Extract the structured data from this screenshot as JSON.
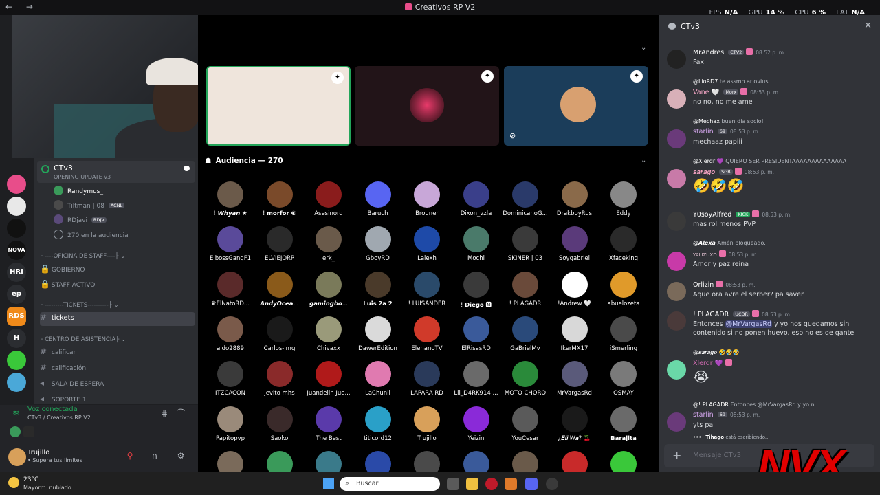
{
  "window": {
    "title": "Creativos RP V2",
    "nav": "← →",
    "perf": [
      {
        "label": "FPS",
        "value": "N/A"
      },
      {
        "label": "GPU",
        "value": "14 %"
      },
      {
        "label": "CPU",
        "value": "6 %"
      },
      {
        "label": "LAT",
        "value": "N/A"
      }
    ]
  },
  "servers": [
    "NOVA",
    "HRI",
    "ep",
    "RDS",
    "H"
  ],
  "sidebar": {
    "voice_channel": {
      "name": "CTv3",
      "sub": "OPENING UPDATE v3"
    },
    "members": [
      {
        "name": "Randymus_",
        "dim": false
      },
      {
        "name": "Tiltman | 08",
        "tag": "ACÑL",
        "dim": true
      },
      {
        "name": "RDjavi",
        "tag": "RDJV",
        "dim": true
      },
      {
        "name": "270 en la audiencia",
        "dim": true
      }
    ],
    "cat_staff": "┤----OFICINA DE STAFF----├ ⌄",
    "staff_channels": [
      "GOBIERNO",
      "STAFF ACTIVO"
    ],
    "cat_tickets": "┤---------TICKETS----------├ ⌄",
    "tickets_channel": "tickets",
    "cat_soporte": "┤CENTRO DE ASISTENCIA├ ⌄",
    "soporte_channels": [
      "calificar",
      "calificación",
      "SALA DE ESPERA",
      "SOPORTE 1"
    ],
    "voice_status": {
      "title": "Voz conectada",
      "sub": "CTv3 / Creativos RP V2"
    },
    "user": {
      "name": "Trujillo",
      "status": "• Supera tus límites"
    }
  },
  "stage": {
    "audience_header": "Audiencia — 270",
    "audience": [
      {
        "name": "! 𝙒𝙝𝙮𝙖𝙣 ★",
        "color": "#6b5a4a"
      },
      {
        "name": "! 𝗺𝗼𝗿𝗳𝗼𝗿 ☯",
        "color": "#7a4a2a"
      },
      {
        "name": "Asesinord",
        "color": "#8a1c1c"
      },
      {
        "name": "Baruch",
        "color": "#5865f2"
      },
      {
        "name": "Brouner",
        "color": "#c8a7d8"
      },
      {
        "name": "Dixon_vzla",
        "color": "#3a3f8a"
      },
      {
        "name": "DominicanoG...",
        "color": "#2a3a6a"
      },
      {
        "name": "DrakboyRus",
        "color": "#8a6a4a"
      },
      {
        "name": "Eddy",
        "color": "#888888"
      },
      {
        "name": "ElbossGangF1",
        "color": "#5a4a9a"
      },
      {
        "name": "ELVIEJORP",
        "color": "#2a2a2a"
      },
      {
        "name": "erk_",
        "color": "#6a5a4a"
      },
      {
        "name": "GboyRD",
        "color": "#a0a8b0"
      },
      {
        "name": "Lalexh",
        "color": "#1e4aa8"
      },
      {
        "name": "Mochi",
        "color": "#4a7a6a"
      },
      {
        "name": "SKINER | 03",
        "color": "#3a3a3a"
      },
      {
        "name": "Soygabriel",
        "color": "#5a3a7a"
      },
      {
        "name": "Xfaceking",
        "color": "#2a2a2a"
      },
      {
        "name": "♛ElNatoRD...",
        "color": "#5a2a2a"
      },
      {
        "name": "𝘼𝙣𝙙𝙮𝙊𝙘𝙚𝙖...",
        "color": "#8a5a1a"
      },
      {
        "name": "𝙜𝙖𝙢𝙞𝙣𝙜𝙗𝙤...",
        "color": "#7a7a5a"
      },
      {
        "name": "𝗟𝘂𝗶𝘀 𝟮𝗮 𝟮",
        "color": "#4a3a2a"
      },
      {
        "name": "! LUISANDER",
        "color": "#2a4a6a"
      },
      {
        "name": "! 𝗗𝗶𝗲𝗴𝗼 🅼",
        "color": "#3a3a3a"
      },
      {
        "name": "! PLAGADR",
        "color": "#6a4a3a"
      },
      {
        "name": "!Andrew 🤍",
        "color": "#ffffff"
      },
      {
        "name": "abuelozeta",
        "color": "#e09a2a"
      },
      {
        "name": "aldo2889",
        "color": "#7a5a4a"
      },
      {
        "name": "Carlos-lmg",
        "color": "#1a1a1a"
      },
      {
        "name": "Chivaxx",
        "color": "#9a9a7a"
      },
      {
        "name": "DawerEdition",
        "color": "#dadada"
      },
      {
        "name": "ElenanoTV",
        "color": "#d03a2a"
      },
      {
        "name": "ElRisasRD",
        "color": "#3a5a9a"
      },
      {
        "name": "GaBrielMv",
        "color": "#2a4a7a"
      },
      {
        "name": "IkerMX17",
        "color": "#d8d8d8"
      },
      {
        "name": "iSmerling",
        "color": "#4a4a4a"
      },
      {
        "name": "ITZCACON",
        "color": "#3a3a3a"
      },
      {
        "name": "jevito mhs",
        "color": "#8a2a2a"
      },
      {
        "name": "Juandelin Jue...",
        "color": "#b01a1a"
      },
      {
        "name": "LaChunli",
        "color": "#e07ab0"
      },
      {
        "name": "LAPARA RD",
        "color": "#2a3a5a"
      },
      {
        "name": "Lil_D4RK914 ...",
        "color": "#6a6a6a"
      },
      {
        "name": "MOTO CHORO",
        "color": "#2a8a3a"
      },
      {
        "name": "MrVargasRd",
        "color": "#5a5a7a"
      },
      {
        "name": "OSMAY",
        "color": "#7a7a7a"
      },
      {
        "name": "Papitopvp",
        "color": "#9a8a7a"
      },
      {
        "name": "Saoko",
        "color": "#3a2a2a"
      },
      {
        "name": "The Best",
        "color": "#5a3aaa"
      },
      {
        "name": "titicord12",
        "color": "#2aa0c8"
      },
      {
        "name": "Trujillo",
        "color": "#d8a05a"
      },
      {
        "name": "Yeizin",
        "color": "#8a2ad8"
      },
      {
        "name": "YouCesar",
        "color": "#5a5a5a"
      },
      {
        "name": "¿𝑬𝒍𝒊 𝑾𝒂? 🍒",
        "color": "#1a1a1a"
      },
      {
        "name": "𝗕𝗮𝗿𝗮𝗷𝗶𝘁𝗮",
        "color": "#6a6a6a"
      },
      {
        "name": "",
        "color": "#7a6a5a"
      },
      {
        "name": "",
        "color": "#3a9a5a"
      },
      {
        "name": "",
        "color": "#3a7a8a"
      },
      {
        "name": "",
        "color": "#2a4aa8"
      },
      {
        "name": "",
        "color": "#4a4a4a"
      },
      {
        "name": "",
        "color": "#3a5a9a"
      },
      {
        "name": "",
        "color": "#6a5a4a"
      },
      {
        "name": "",
        "color": "#c82a2a"
      },
      {
        "name": "",
        "color": "#3ac83a"
      }
    ]
  },
  "chat": {
    "title": "CTv3",
    "input_placeholder": "Mensaje CTv3",
    "typing": {
      "who": "Tihago",
      "text": " está escribiendo..."
    },
    "messages": [
      {
        "author": "MrAndres",
        "tag": "CTV2",
        "time": "08:52 p. m.",
        "text": "Fax",
        "color": "#222"
      },
      {
        "reply_who": "@LioRD7",
        "reply_text": " te assmo arlovius",
        "author": "Vane 🤍",
        "author_color": "#f7a8c8",
        "tag": "Morx",
        "time": "08:53 p. m.",
        "text": "no no, no me ame",
        "color": "#d8b0b8"
      },
      {
        "reply_who": "@Mechax",
        "reply_text": " buen dia socio!",
        "author": "starlin",
        "author_color": "#d6a8f0",
        "tag": "69",
        "time": "08:53 p. m.",
        "text": "mechaaz papiii",
        "color": "#6a3a7a"
      },
      {
        "reply_who": "@Xlerdr 💜",
        "reply_text": " QUIERO SER PRESIDENTAAAAAAAAAAAAAA",
        "author": "𝒔𝒂𝒓𝒂𝒈𝒐",
        "author_color": "#f0a0c0",
        "tag": "SGB",
        "time": "08:53 p. m.",
        "text": "",
        "color": "#c87aa8"
      },
      {
        "author": "Y0soyAlfred",
        "author_color": "#ffffff",
        "tag": "KICK",
        "time": "08:53 p. m.",
        "text": "mas rol menos PVP",
        "color": "#3a3a3a"
      },
      {
        "reply_who": "@𝘼𝙡𝙚𝙭𝙖",
        "reply_text": " Amén bloqueado.",
        "author": "YALIZUXD",
        "author_color": "#e0c0d0",
        "tag": "",
        "time": "08:53 p. m.",
        "text": "Amor y paz reina",
        "color": "#c83aa8"
      },
      {
        "author": "Orlizin",
        "author_color": "#ffffff",
        "tag": "",
        "time": "08:53 p. m.",
        "text": "Aque ora avre el serber? pa saver",
        "color": "#7a6a5a"
      },
      {
        "author": "! PLAGADR",
        "author_color": "#ffffff",
        "tag": "UCDR",
        "time": "08:53 p. m.",
        "text_pre": "Entonces ",
        "mention": "@MrVargasRd",
        "text": " y yo nos quedamos sin contenido si no ponen huevo. eso no es de gantel",
        "color": "#4a3a3a"
      },
      {
        "reply_who": "@𝒔𝒂𝒓𝒂𝒈𝒐",
        "reply_text": " 🤣🤣🤣",
        "author": "Xlerdr 💜",
        "author_color": "#d06ab0",
        "tag": "",
        "time": "",
        "text": "😭",
        "color": "#6ad8a8"
      },
      {
        "reply_who": "@! PLAGADR",
        "reply_text": " Entonces @MrVargasRd y yo n...",
        "author": "starlin",
        "author_color": "#d6a8f0",
        "tag": "69",
        "time": "08:53 p. m.",
        "text": "yts pa",
        "color": "#6a3a7a"
      }
    ],
    "emoji_row": "🤣🤣🤣"
  },
  "taskbar": {
    "weather_temp": "23°C",
    "weather_desc": "Mayorm. nublado",
    "search": "Buscar",
    "overlay_logo": "NVX"
  }
}
